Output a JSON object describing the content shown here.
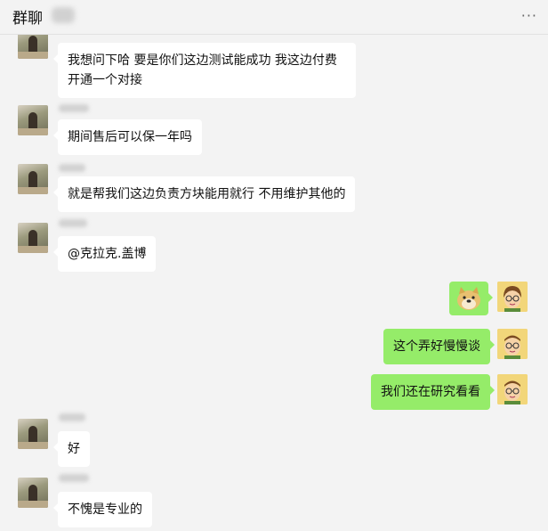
{
  "header": {
    "title": "群聊",
    "more_icon": "more-dots-icon",
    "more_glyph": "···"
  },
  "messages": [
    {
      "side": "left",
      "text": "我想问下哈 要是你们这边测试能成功 我这边付费开通一个对接"
    },
    {
      "side": "left",
      "text": "期间售后可以保一年吗"
    },
    {
      "side": "left",
      "text": "就是帮我们这边负责方块能用就行 不用维护其他的"
    },
    {
      "side": "left",
      "text": "@克拉克.盖博"
    },
    {
      "side": "right",
      "sticker": "doge-sticker-icon"
    },
    {
      "side": "right",
      "text": "这个弄好慢慢谈"
    },
    {
      "side": "right",
      "text": "我们还在研究看看"
    },
    {
      "side": "left",
      "text": "好"
    },
    {
      "side": "left",
      "text": "不愧是专业的"
    }
  ],
  "colors": {
    "background": "#f3f3f3",
    "incoming_bubble": "#ffffff",
    "outgoing_bubble": "#95ec69"
  }
}
